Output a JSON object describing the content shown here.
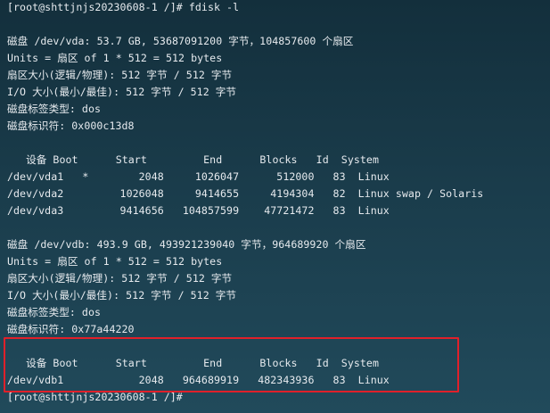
{
  "terminal": {
    "lines": [
      "[root@shttjnjs20230608-1 /]# fdisk -l",
      "",
      "磁盘 /dev/vda: 53.7 GB, 53687091200 字节，104857600 个扇区",
      "Units = 扇区 of 1 * 512 = 512 bytes",
      "扇区大小(逻辑/物理): 512 字节 / 512 字节",
      "I/O 大小(最小/最佳): 512 字节 / 512 字节",
      "磁盘标签类型: dos",
      "磁盘标识符: 0x000c13d8",
      "",
      "   设备 Boot      Start         End      Blocks   Id  System",
      "/dev/vda1   *        2048     1026047      512000   83  Linux",
      "/dev/vda2         1026048     9414655     4194304   82  Linux swap / Solaris",
      "/dev/vda3         9414656   104857599    47721472   83  Linux",
      "",
      "磁盘 /dev/vdb: 493.9 GB, 493921239040 字节，964689920 个扇区",
      "Units = 扇区 of 1 * 512 = 512 bytes",
      "扇区大小(逻辑/物理): 512 字节 / 512 字节",
      "I/O 大小(最小/最佳): 512 字节 / 512 字节",
      "磁盘标签类型: dos",
      "磁盘标识符: 0x77a44220",
      "",
      "   设备 Boot      Start         End      Blocks   Id  System",
      "/dev/vdb1            2048   964689919   482343936   83  Linux",
      "[root@shttjnjs20230608-1 /]#"
    ]
  },
  "colors": {
    "background": "#1a3c4b",
    "text": "#e6eaee",
    "highlight_border": "#e0202a"
  }
}
